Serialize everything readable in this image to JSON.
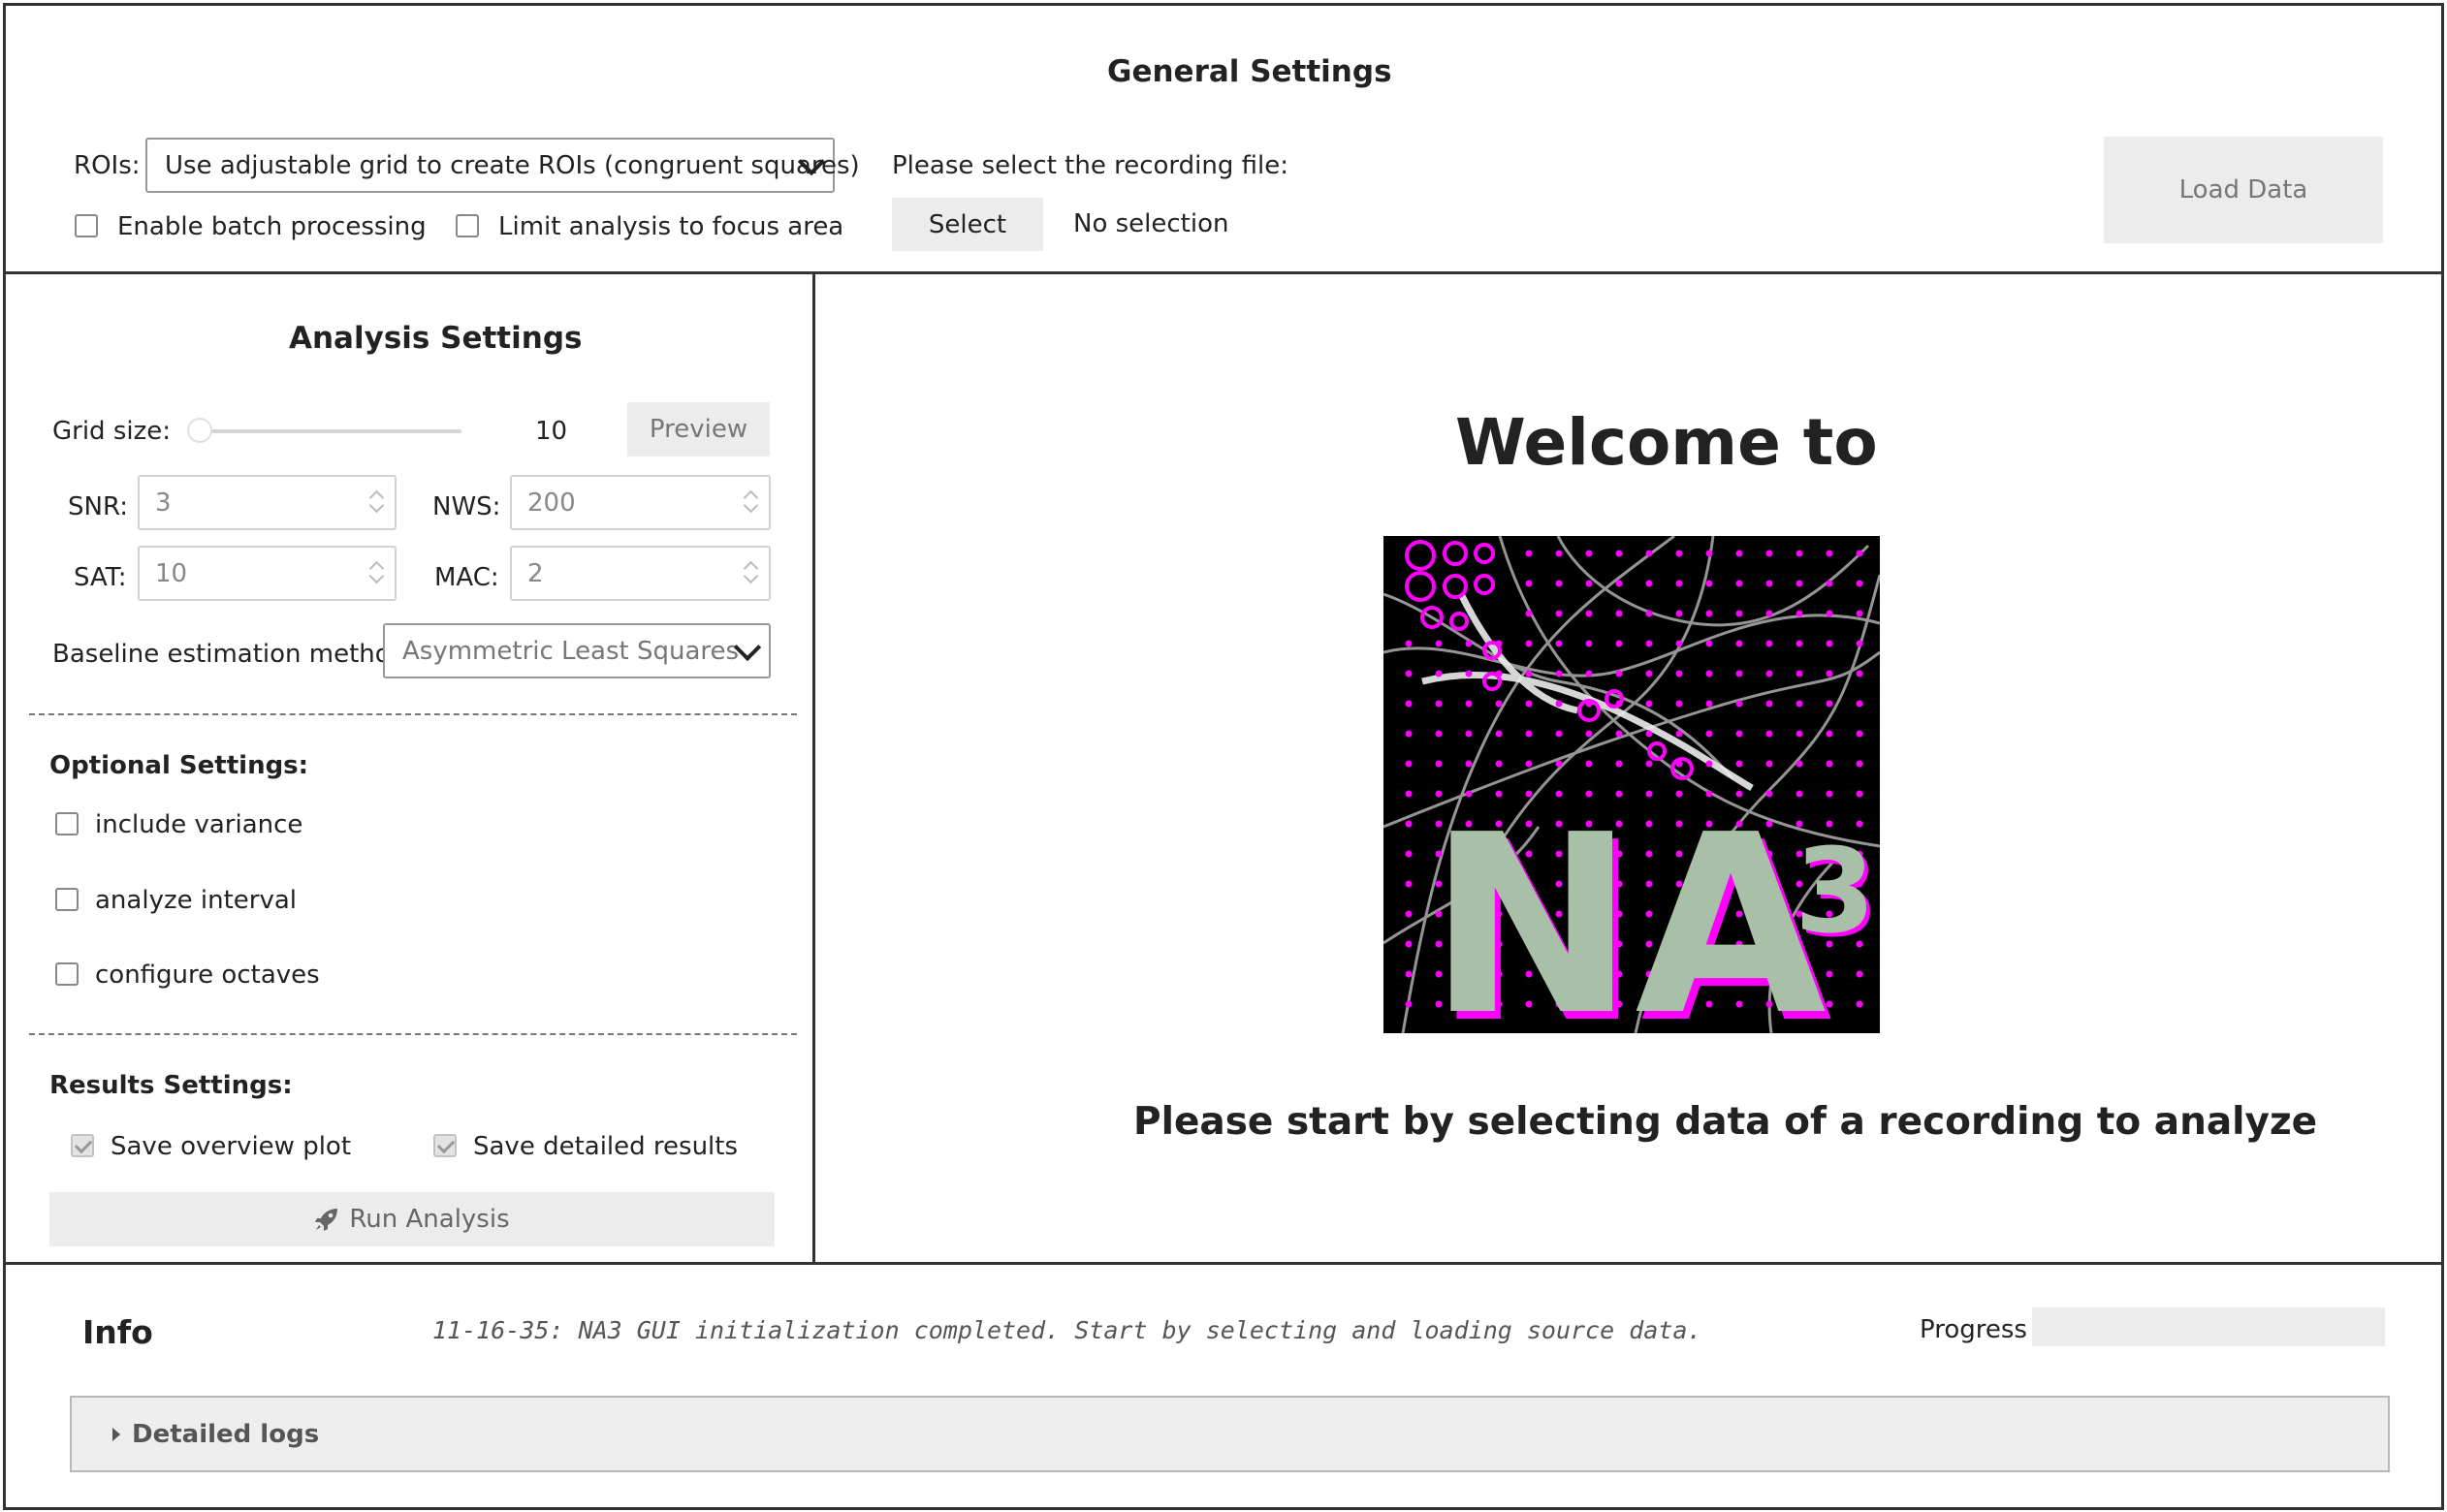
{
  "general": {
    "title": "General Settings",
    "rois_label": "ROIs:",
    "rois_value": "Use adjustable grid to create ROIs (congruent squares)",
    "batch_label": "Enable batch processing",
    "batch_checked": false,
    "focus_label": "Limit analysis to focus area",
    "focus_checked": false,
    "recording_prompt": "Please select the recording file:",
    "select_label": "Select",
    "selection_status": "No selection",
    "load_label": "Load Data"
  },
  "analysis": {
    "title": "Analysis Settings",
    "grid_label": "Grid size:",
    "grid_value": "10",
    "preview_label": "Preview",
    "snr_label": "SNR:",
    "snr_value": "3",
    "nws_label": "NWS:",
    "nws_value": "200",
    "sat_label": "SAT:",
    "sat_value": "10",
    "mac_label": "MAC:",
    "mac_value": "2",
    "baseline_label": "Baseline estimation method:",
    "baseline_value": "Asymmetric Least Squares"
  },
  "optional": {
    "title": "Optional Settings:",
    "items": [
      {
        "label": "include variance",
        "checked": false
      },
      {
        "label": "analyze interval",
        "checked": false
      },
      {
        "label": "configure octaves",
        "checked": false
      }
    ]
  },
  "results": {
    "title": "Results Settings:",
    "overview_label": "Save overview plot",
    "overview_checked": true,
    "detailed_label": "Save detailed results",
    "detailed_checked": true,
    "run_label": "Run Analysis"
  },
  "welcome": {
    "title": "Welcome to",
    "logo_text": "NA",
    "logo_superscript": "3",
    "subtitle": "Please start by selecting data of a recording to analyze"
  },
  "info": {
    "title": "Info",
    "log_message": "11-16-35: NA3 GUI initialization completed. Start by selecting and loading source data.",
    "progress_label": "Progress",
    "progress_value": 0,
    "details_label": "Detailed logs"
  },
  "colors": {
    "accent_magenta": "#ff00ff",
    "logo_text": "#a8bfa8",
    "button_bg": "#ececec"
  }
}
